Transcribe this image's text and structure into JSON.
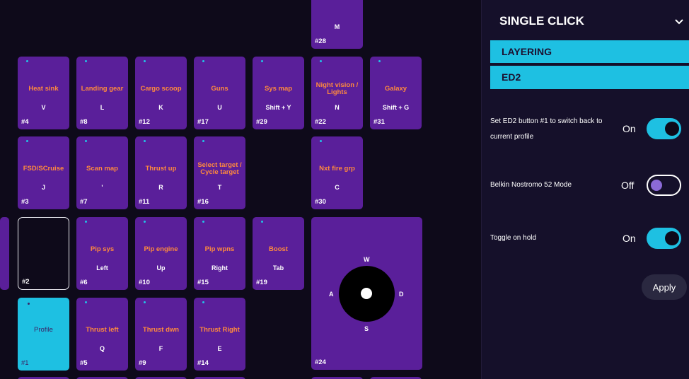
{
  "keys": [
    {
      "action": "",
      "binding": "M",
      "number": "#28"
    },
    {
      "action": "Heat sink",
      "binding": "V",
      "number": "#4"
    },
    {
      "action": "Landing gear",
      "binding": "L",
      "number": "#8"
    },
    {
      "action": "Cargo scoop",
      "binding": "K",
      "number": "#12"
    },
    {
      "action": "Guns",
      "binding": "U",
      "number": "#17"
    },
    {
      "action": "Sys map",
      "binding": "Shift + Y",
      "number": "#29"
    },
    {
      "action": "Night vision / Lights",
      "binding": "N",
      "number": "#22"
    },
    {
      "action": "Galaxy",
      "binding": "Shift + G",
      "number": "#31"
    },
    {
      "action": "FSD/SCruise",
      "binding": "J",
      "number": "#3"
    },
    {
      "action": "Scan map",
      "binding": "'",
      "number": "#7"
    },
    {
      "action": "Thrust up",
      "binding": "R",
      "number": "#11"
    },
    {
      "action": "Select target / Cycle target",
      "binding": "T",
      "number": "#16"
    },
    {
      "action": "Nxt fire grp",
      "binding": "C",
      "number": "#30"
    },
    {
      "action": "",
      "binding": "",
      "number": "#2"
    },
    {
      "action": "Pip sys",
      "binding": "Left",
      "number": "#6"
    },
    {
      "action": "Pip engine",
      "binding": "Up",
      "number": "#10"
    },
    {
      "action": "Pip wpns",
      "binding": "Right",
      "number": "#15"
    },
    {
      "action": "Boost",
      "binding": "Tab",
      "number": "#19"
    },
    {
      "action": "Profile",
      "binding": "",
      "number": "#1"
    },
    {
      "action": "Thrust left",
      "binding": "Q",
      "number": "#5"
    },
    {
      "action": "Thrust dwn",
      "binding": "F",
      "number": "#9"
    },
    {
      "action": "Thrust Right",
      "binding": "E",
      "number": "#14"
    }
  ],
  "joystick": {
    "up": "W",
    "left": "A",
    "right": "D",
    "down": "S",
    "number": "#24"
  },
  "panel": {
    "title": "SINGLE CLICK",
    "chevron_icon": "chevron-down-icon",
    "tabs": [
      "LAYERING",
      "ED2"
    ],
    "settings": [
      {
        "label": "Set ED2 button #1 to switch back to current profile",
        "state": "On",
        "on": true
      },
      {
        "label": "Belkin Nostromo 52 Mode",
        "state": "Off",
        "on": false
      },
      {
        "label": "Toggle on hold",
        "state": "On",
        "on": true
      }
    ],
    "apply_label": "Apply"
  },
  "colors": {
    "background": "#0e0a1a",
    "key": "#5a1f9a",
    "accent": "#1ec0e2",
    "action_text": "#ff8a3d",
    "panel": "#15102a"
  }
}
